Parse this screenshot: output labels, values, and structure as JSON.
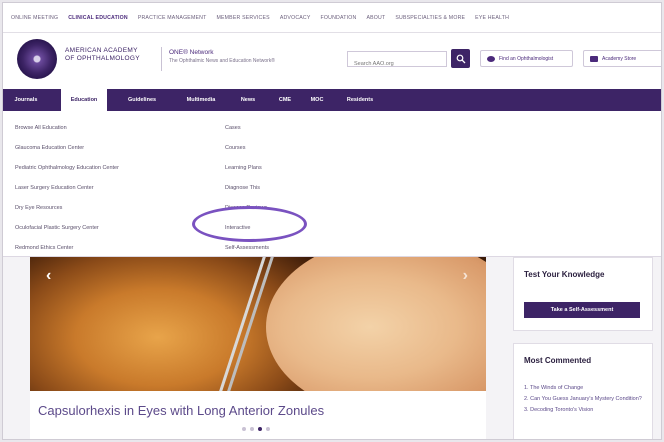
{
  "topbar": {
    "links": [
      {
        "label": "ONLINE MEETING"
      },
      {
        "label": "CLINICAL EDUCATION",
        "active": true
      },
      {
        "label": "PRACTICE MANAGEMENT"
      },
      {
        "label": "MEMBER SERVICES"
      },
      {
        "label": "ADVOCACY"
      },
      {
        "label": "FOUNDATION"
      },
      {
        "label": "ABOUT"
      },
      {
        "label": "SUBSPECIALTIES & MORE"
      },
      {
        "label": "EYE HEALTH"
      }
    ]
  },
  "header": {
    "logo_line1": "AMERICAN ACADEMY",
    "logo_line2": "OF OPHTHALMOLOGY",
    "network_title": "ONE® Network",
    "network_subtitle": "The Ophthalmic News and Education Network®",
    "search_placeholder": "Search AAO.org",
    "find_label": "Find an Ophthalmologist",
    "store_label": "Academy Store"
  },
  "nav": {
    "items": [
      {
        "label": "Journals"
      },
      {
        "label": "Education",
        "active": true
      },
      {
        "label": "Guidelines"
      },
      {
        "label": "Multimedia"
      },
      {
        "label": "News"
      },
      {
        "label": "CME"
      },
      {
        "label": "MOC"
      },
      {
        "label": "Residents"
      }
    ]
  },
  "dropdown": {
    "left": [
      "Browse All Education",
      "Glaucoma Education Center",
      "Pediatric Ophthalmology Education Center",
      "Laser Surgery Education Center",
      "Dry Eye Resources",
      "Oculofacial Plastic Surgery Center",
      "Redmond Ethics Center"
    ],
    "right": [
      "Cases",
      "Courses",
      "Learning Plans",
      "Diagnose This",
      "Disease Reviews",
      "Interactive",
      "Self-Assessments"
    ]
  },
  "hero": {
    "caption": "Capsulorhexis in Eyes with Long Anterior Zonules",
    "prev_glyph": "‹",
    "next_glyph": "›"
  },
  "sidebar": {
    "test_title": "Test Your Knowledge",
    "test_button": "Take a Self-Assessment",
    "commented_title": "Most Commented",
    "commented_items": [
      "1. The Winds of Change",
      "2. Can You Guess January's Mystery Condition?",
      "3. Decoding Toronto's Vision"
    ]
  },
  "colors": {
    "brand_purple": "#3d2466",
    "highlight_ring": "#7a52c0"
  }
}
